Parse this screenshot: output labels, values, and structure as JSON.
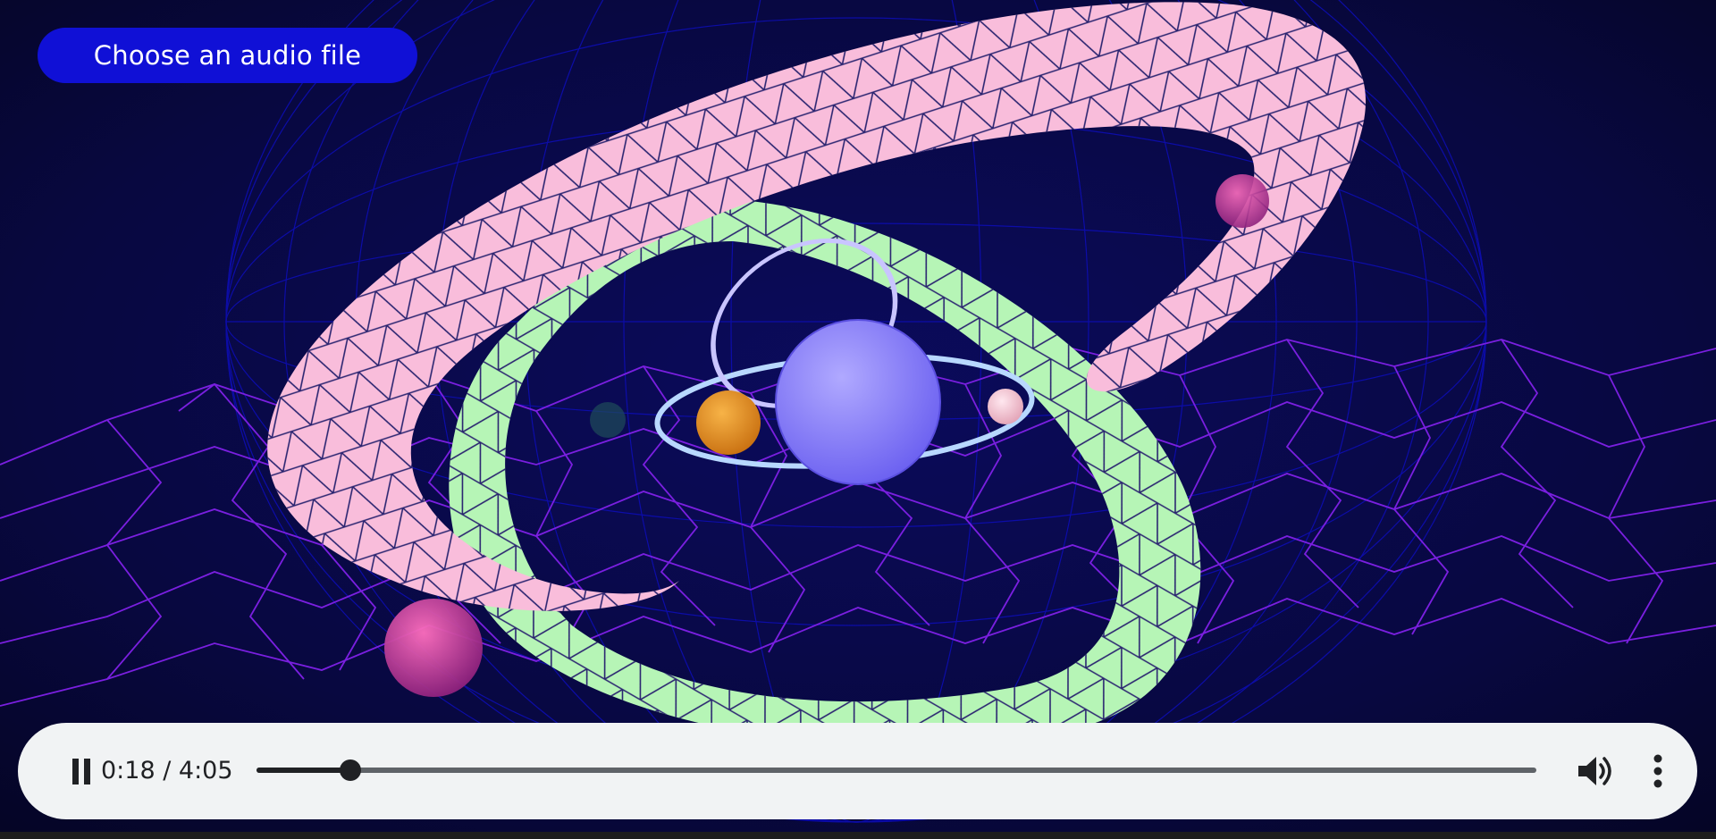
{
  "upload": {
    "label": "Choose an audio file"
  },
  "player": {
    "state": "playing",
    "time_label": "0:18 / 4:05",
    "current_seconds": 18,
    "duration_seconds": 245,
    "progress_fraction": 0.0735,
    "icons": {
      "play_pause": "pause-icon",
      "volume": "volume-icon",
      "menu": "more-vert-icon"
    }
  },
  "colors": {
    "background": "#06062a",
    "upload_button": "#1010d6",
    "upload_text": "#ffffff",
    "player_bg": "#f1f3f4",
    "player_fg": "#202124",
    "pink_ring": "#f9bddb",
    "green_ring": "#b6f5b6",
    "wire_mesh": "#7a1fe0",
    "wire_sphere": "#0a0aa8",
    "central_sphere": "#8c82f5",
    "orange_planet": "#e6931f"
  }
}
